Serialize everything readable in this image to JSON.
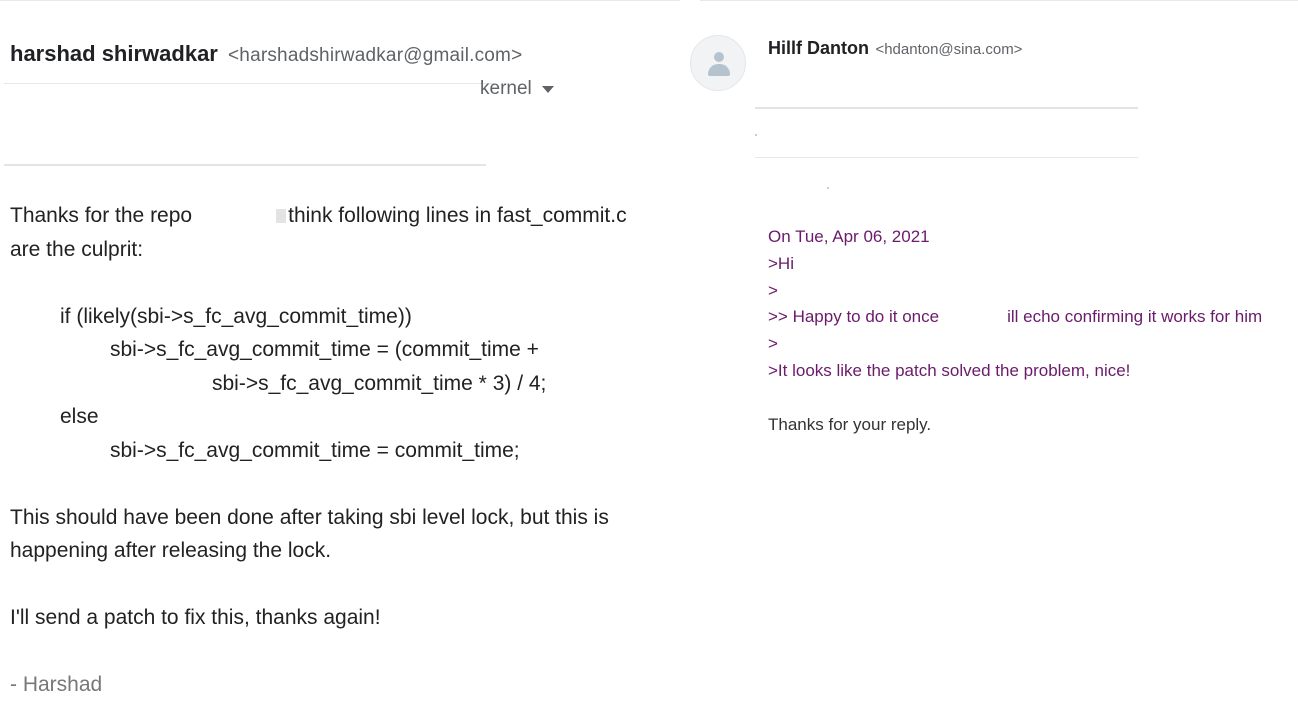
{
  "left_email": {
    "sender_name": "harshad shirwadkar",
    "sender_email": "<harshadshirwadkar@gmail.com>",
    "recipients_fragment": "kernel",
    "body": {
      "intro_part1": "Thanks for the repo",
      "intro_part2": "think following lines in fast_commit.c",
      "intro_line2": "are the culprit:",
      "code": [
        "if (likely(sbi->s_fc_avg_commit_time))",
        "sbi->s_fc_avg_commit_time = (commit_time +",
        "sbi->s_fc_avg_commit_time * 3) / 4;",
        "else",
        "sbi->s_fc_avg_commit_time = commit_time;"
      ],
      "para2_line1": "This should have been done after taking sbi level lock, but this is",
      "para2_line2": "happening after releasing the lock.",
      "para3": "I'll send a patch to fix this, thanks again!",
      "signature": "- Harshad"
    }
  },
  "right_email": {
    "sender_name": "Hillf Danton",
    "sender_email": "<hdanton@sina.com>",
    "quoted": {
      "header": "On Tue, Apr 06, 2021",
      "line_hi": ">Hi",
      "line_gt1": ">",
      "line_happy_part1": ">> Happy to do it once",
      "line_happy_part2": "ill echo confirming it works for him",
      "line_gt2": ">",
      "line_solved": ">It looks like the patch solved the problem, nice!"
    },
    "reply": "Thanks for your reply."
  },
  "icons": {
    "avatar": "person-avatar-icon",
    "recipients_toggle": "caret-down-icon"
  },
  "colors": {
    "quote_text": "#6a1b6a",
    "secondary_text": "#5f6368",
    "signature_text": "#777777"
  }
}
